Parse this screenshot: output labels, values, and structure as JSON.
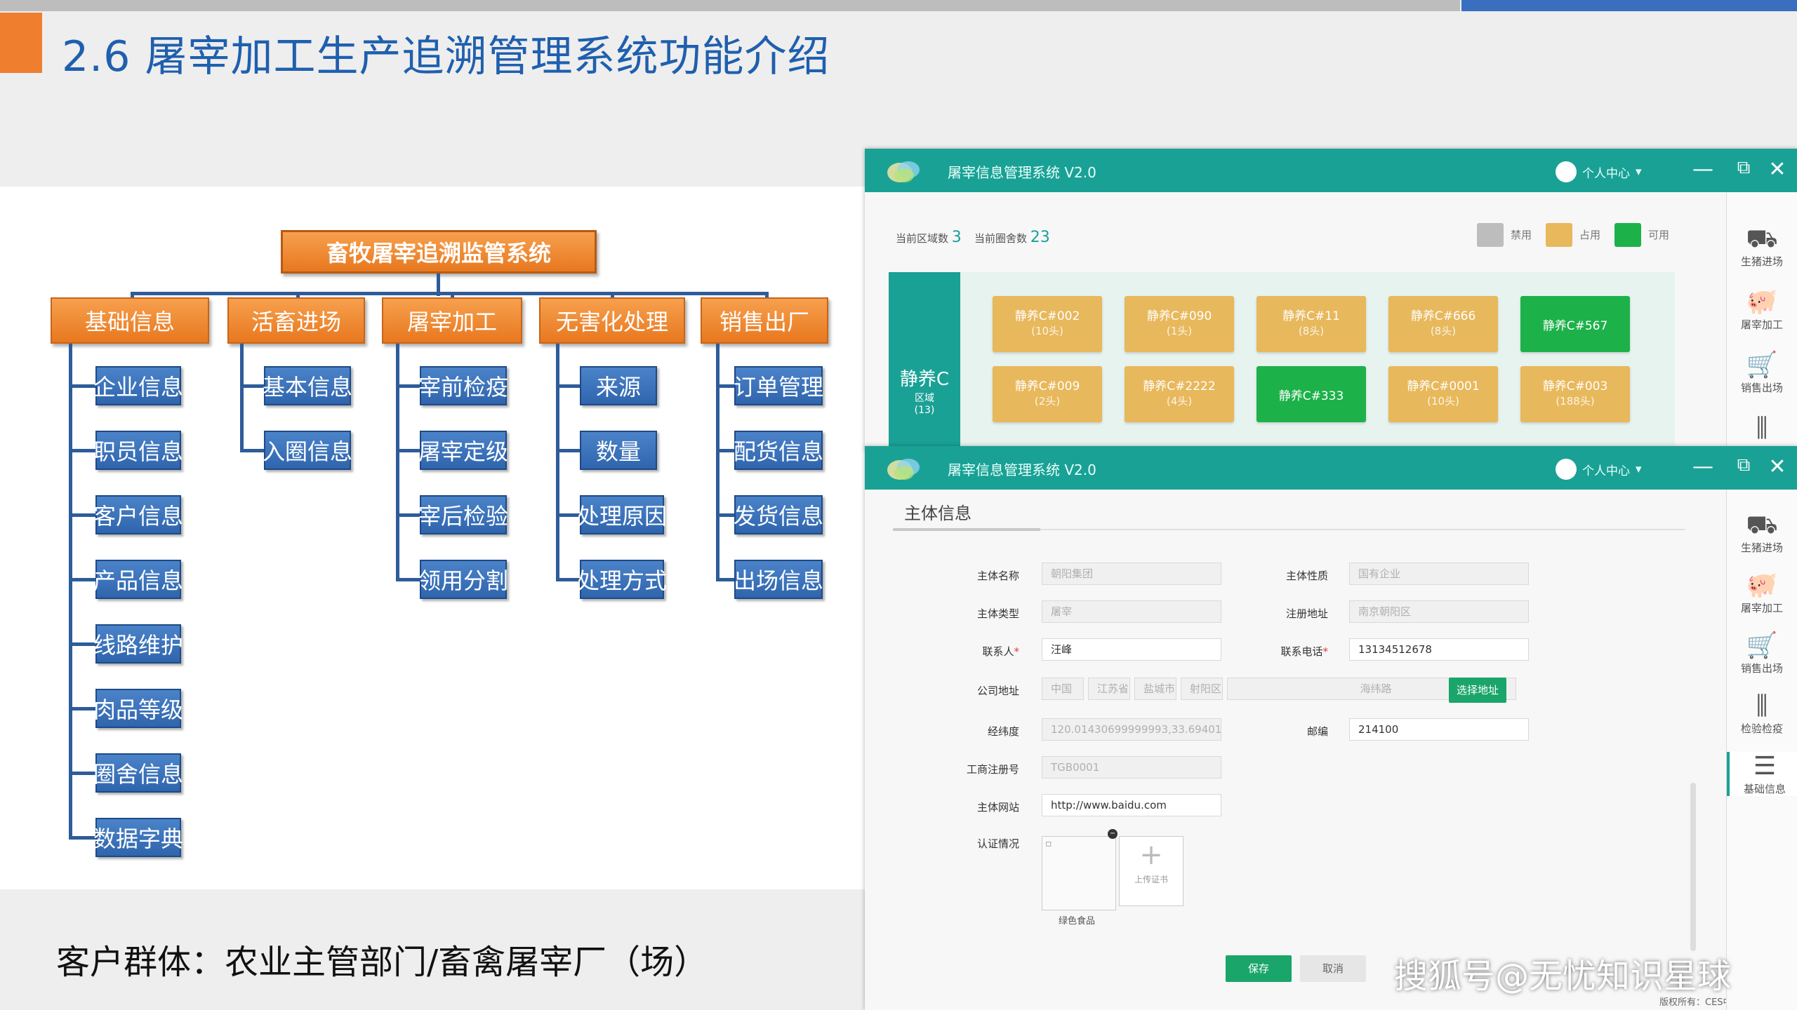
{
  "slide": {
    "title": "2.6 屠宰加工生产追溯管理系统功能介绍",
    "footer": "客户群体：农业主管部门/畜禽屠宰厂（场）",
    "watermark": "搜狐号@无忧知识星球"
  },
  "org": {
    "root": "畜牧屠宰追溯监管系统",
    "categories": [
      {
        "label": "基础信息",
        "items": [
          "企业信息",
          "职员信息",
          "客户信息",
          "产品信息",
          "线路维护",
          "肉品等级",
          "圈舍信息",
          "数据字典"
        ]
      },
      {
        "label": "活畜进场",
        "items": [
          "基本信息",
          "入圈信息"
        ]
      },
      {
        "label": "屠宰加工",
        "items": [
          "宰前检疫",
          "屠宰定级",
          "宰后检验",
          "领用分割"
        ]
      },
      {
        "label": "无害化处理",
        "items": [
          "来源",
          "数量",
          "处理原因",
          "处理方式"
        ]
      },
      {
        "label": "销售出厂",
        "items": [
          "订单管理",
          "配货信息",
          "发货信息",
          "出场信息"
        ]
      }
    ]
  },
  "app": {
    "title": "屠宰信息管理系统 V2.0",
    "user_menu": "个人中心",
    "minimize": "—",
    "restore": "⧉",
    "close": "✕",
    "sidebar": [
      "生猪进场",
      "屠宰加工",
      "销售出场",
      "检验检疫",
      "基础信息"
    ],
    "colors": {
      "teal": "#1aa195",
      "occupied": "#e8b85c",
      "available": "#1db14a",
      "disabled": "#bdbdbd"
    }
  },
  "pens": {
    "area_count_label": "当前区域数",
    "area_count": "3",
    "pen_count_label": "当前圈舍数",
    "pen_count": "23",
    "legend": [
      "禁用",
      "占用",
      "可用"
    ],
    "zone": {
      "name": "静养C",
      "sub": "区域",
      "count": "(13)"
    },
    "row1": [
      {
        "name": "静养C#002",
        "count": "(10头)",
        "status": "occupied"
      },
      {
        "name": "静养C#090",
        "count": "(1头)",
        "status": "occupied"
      },
      {
        "name": "静养C#11",
        "count": "(8头)",
        "status": "occupied"
      },
      {
        "name": "静养C#666",
        "count": "(8头)",
        "status": "occupied"
      },
      {
        "name": "静养C#567",
        "count": "",
        "status": "available"
      }
    ],
    "row2": [
      {
        "name": "静养C#009",
        "count": "(2头)",
        "status": "occupied"
      },
      {
        "name": "静养C#2222",
        "count": "(4头)",
        "status": "occupied"
      },
      {
        "name": "静养C#333",
        "count": "",
        "status": "available"
      },
      {
        "name": "静养C#0001",
        "count": "(10头)",
        "status": "occupied"
      },
      {
        "name": "静养C#003",
        "count": "(188头)",
        "status": "occupied"
      }
    ]
  },
  "form": {
    "section": "主体信息",
    "entity_name": {
      "label": "主体名称",
      "value": "朝阳集团"
    },
    "entity_nature": {
      "label": "主体性质",
      "value": "国有企业"
    },
    "entity_type": {
      "label": "主体类型",
      "value": "屠宰"
    },
    "reg_address": {
      "label": "注册地址",
      "value": "南京朝阳区"
    },
    "contact": {
      "label": "联系人",
      "value": "汪峰"
    },
    "phone": {
      "label": "联系电话",
      "value": "13134512678"
    },
    "company_address": {
      "label": "公司地址",
      "parts": [
        "中国",
        "江苏省",
        "盐城市",
        "射阳区"
      ],
      "detail": "海纬路",
      "button": "选择地址"
    },
    "coords": {
      "label": "经纬度",
      "value": "120.01430699999993,33.69401"
    },
    "postcode": {
      "label": "邮编",
      "value": "214100"
    },
    "biz_reg": {
      "label": "工商注册号",
      "value": "TGB0001"
    },
    "website": {
      "label": "主体网站",
      "value": "http://www.baidu.com"
    },
    "cert": {
      "label": "认证情况",
      "caption": "绿色食品",
      "upload_label": "上传证书"
    },
    "save": "保存",
    "cancel": "取消",
    "copyright": "版权所有：CES中信信息"
  }
}
